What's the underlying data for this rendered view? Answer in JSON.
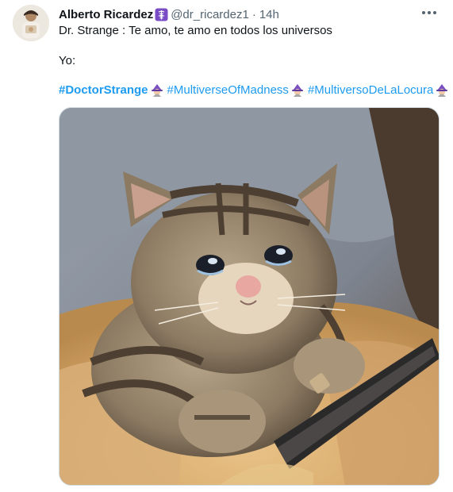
{
  "tweet": {
    "author_name": "Alberto Ricardez",
    "handle": "@dr_ricardez1",
    "separator": "·",
    "time": "14h",
    "line1": "Dr. Strange : Te amo, te amo en todos los universos",
    "line2": "Yo:",
    "hashtags": [
      "#DoctorStrange",
      "#MultiverseOfMadness",
      "#MultiversoDeLaLocura"
    ],
    "hashtag_emoji": "mage-emoji",
    "badge_icon": "caduceus-badge-icon",
    "more_icon": "more-options-icon",
    "media": {
      "description_icon": "crying-cat-photo"
    }
  },
  "colors": {
    "link": "#1d9bf0",
    "secondary_text": "#536471",
    "badge_purple": "#794bc4"
  }
}
